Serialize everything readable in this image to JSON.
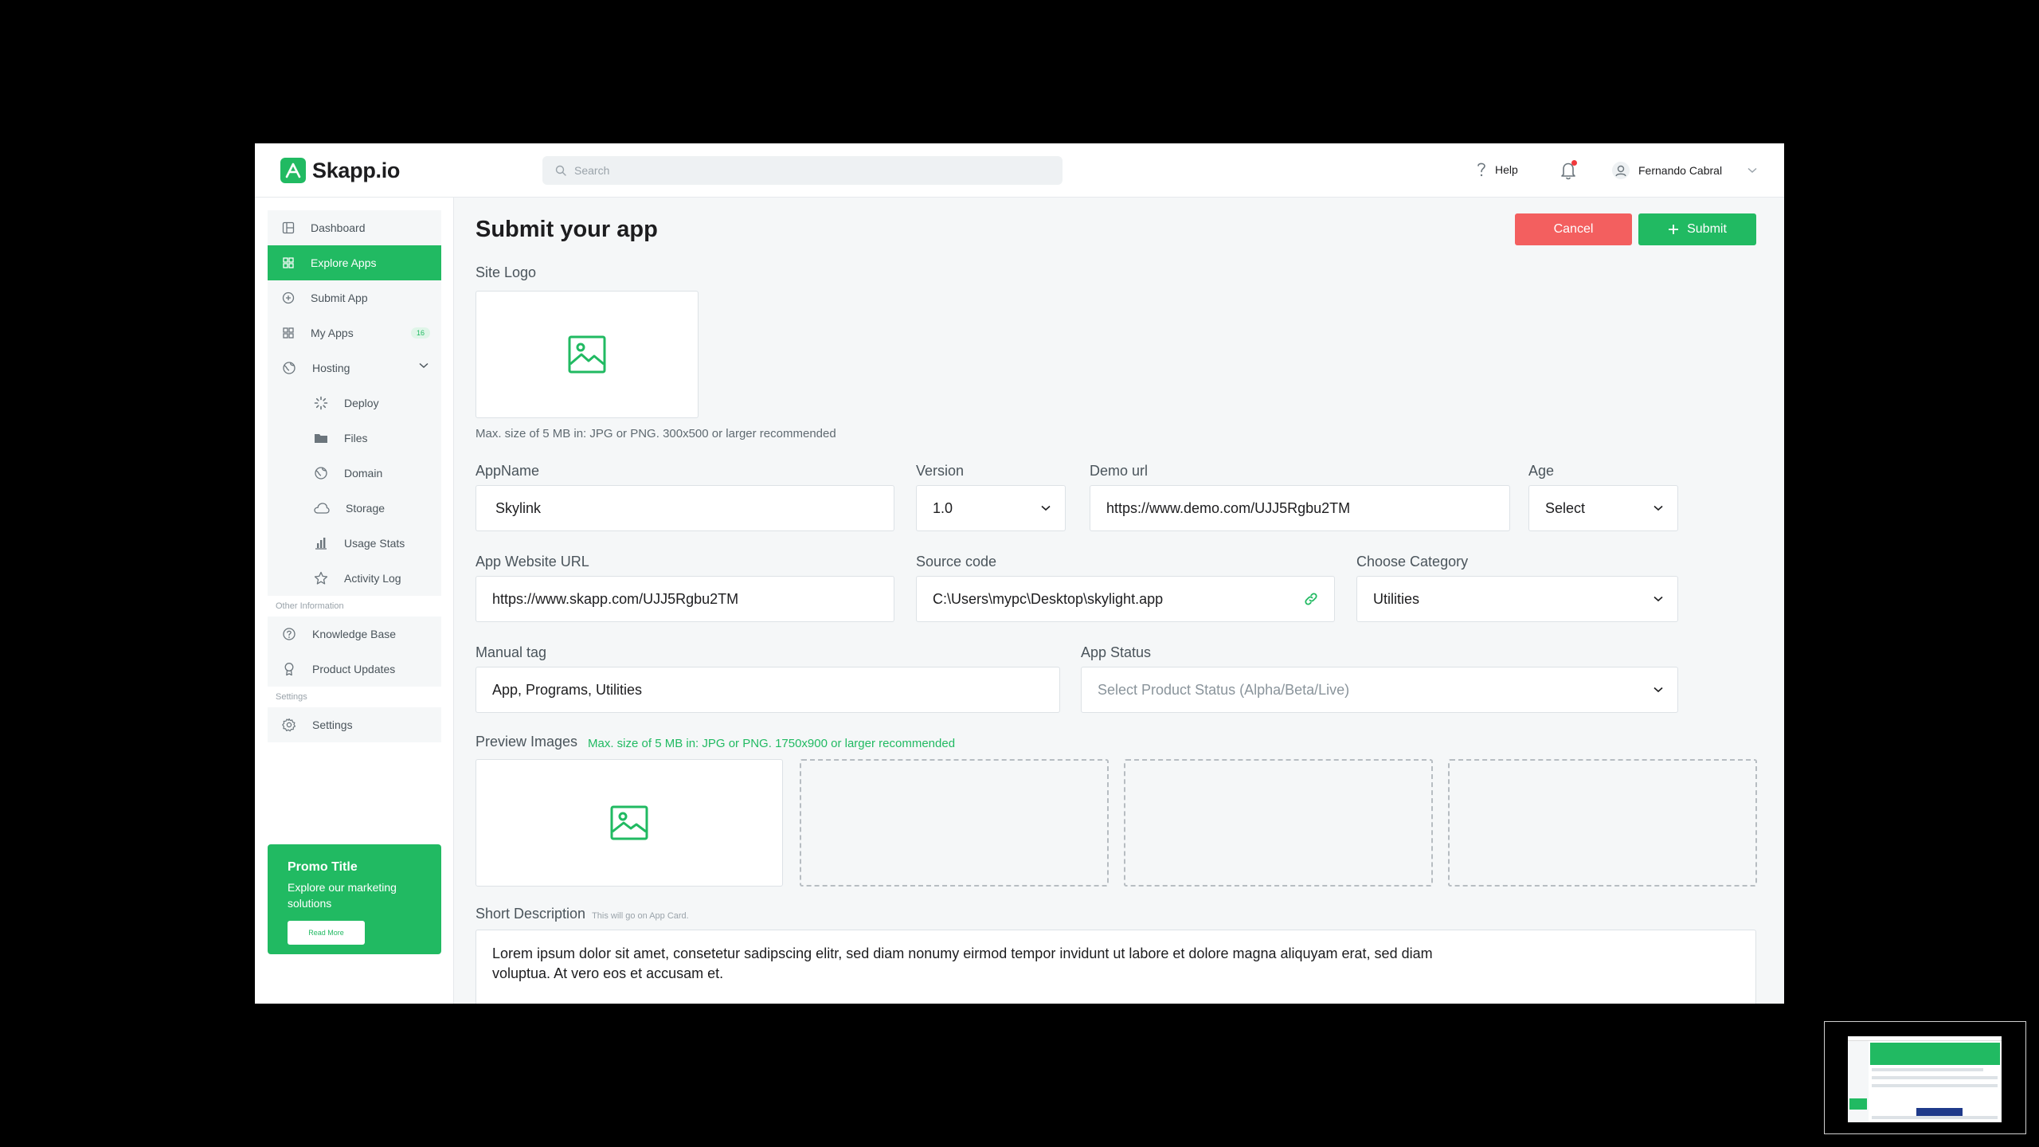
{
  "brand": {
    "name": "Skapp.io",
    "logo_icon": "skapp-logo-icon"
  },
  "header": {
    "search_placeholder": "Search",
    "help_label": "Help",
    "user_name": "Fernando Cabral"
  },
  "sidebar": {
    "items": [
      {
        "label": "Dashboard",
        "icon": "dashboard-icon"
      },
      {
        "label": "Explore Apps",
        "icon": "grid-icon",
        "active": true
      },
      {
        "label": "Submit App",
        "icon": "plus-circle-icon"
      },
      {
        "label": "My Apps",
        "icon": "apps-icon",
        "badge": "16"
      },
      {
        "label": "Hosting",
        "icon": "hosting-icon"
      }
    ],
    "hosting_items": [
      {
        "label": "Deploy",
        "icon": "deploy-icon"
      },
      {
        "label": "Files",
        "icon": "folder-icon"
      },
      {
        "label": "Domain",
        "icon": "globe-icon"
      },
      {
        "label": "Storage",
        "icon": "cloud-icon"
      },
      {
        "label": "Usage Stats",
        "icon": "bar-chart-icon"
      },
      {
        "label": "Activity Log",
        "icon": "star-icon"
      }
    ],
    "other_section_label": "Other Information",
    "other_items": [
      {
        "label": "Knowledge Base",
        "icon": "help-circle-icon"
      },
      {
        "label": "Product Updates",
        "icon": "award-icon"
      }
    ],
    "settings_section_label": "Settings",
    "settings_item": {
      "label": "Settings",
      "icon": "gear-icon"
    },
    "promo": {
      "title": "Promo Title",
      "text": "Explore our marketing solutions",
      "button": "Read More"
    }
  },
  "form": {
    "title": "Submit your app",
    "cancel_label": "Cancel",
    "submit_label": "Submit",
    "site_logo_label": "Site Logo",
    "site_logo_hint": "Max. size of 5 MB in: JPG or PNG. 300x500 or larger recommended",
    "app_name_label": "AppName",
    "app_name_value": "Skylink",
    "version_label": "Version",
    "version_value": "1.0",
    "demo_url_label": "Demo url",
    "demo_url_value": "https://www.demo.com/UJJ5Rgbu2TM",
    "age_label": "Age",
    "age_value": "Select",
    "website_label": "App Website URL",
    "website_value": "https://www.skapp.com/UJJ5Rgbu2TM",
    "source_label": "Source code",
    "source_value": "C:\\Users\\mypc\\Desktop\\skylight.app",
    "category_label": "Choose Category",
    "category_value": "Utilities",
    "tag_label": "Manual tag",
    "tag_value": "App, Programs, Utilities",
    "status_label": "App Status",
    "status_placeholder": "Select Product Status (Alpha/Beta/Live)",
    "preview_label": "Preview Images",
    "preview_hint": "Max. size of 5 MB in: JPG or PNG. 1750x900 or larger recommended",
    "short_desc_label": "Short Description",
    "short_desc_hint": "This will go on App Card.",
    "short_desc_value": "Lorem ipsum dolor sit amet, consetetur sadipscing elitr, sed diam nonumy eirmod tempor invidunt ut labore et dolore magna aliquyam erat, sed diam voluptua. At vero eos et accusam et."
  },
  "colors": {
    "accent": "#21ba62",
    "danger": "#f35f5f",
    "notification_dot": "#f0393c"
  }
}
